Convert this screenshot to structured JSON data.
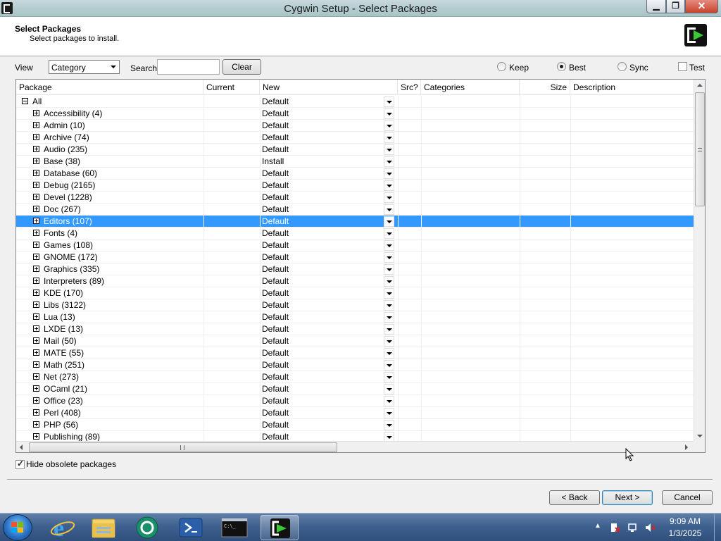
{
  "window": {
    "title": "Cygwin Setup - Select Packages"
  },
  "header": {
    "title": "Select Packages",
    "subtitle": "Select packages to install."
  },
  "toolbar": {
    "view_label": "View",
    "view_value": "Category",
    "search_label": "Search",
    "search_value": "",
    "clear_label": "Clear",
    "modes": [
      {
        "label": "Keep",
        "selected": false
      },
      {
        "label": "Best",
        "selected": true
      },
      {
        "label": "Sync",
        "selected": false
      }
    ],
    "test_label": "Test",
    "test_checked": false
  },
  "columns": [
    "Package",
    "Current",
    "New",
    "Src?",
    "Categories",
    "Size",
    "Description"
  ],
  "rows": [
    {
      "name": "All",
      "new": "Default",
      "level": 0,
      "expanded": true
    },
    {
      "name": "Accessibility (4)",
      "new": "Default",
      "level": 1
    },
    {
      "name": "Admin (10)",
      "new": "Default",
      "level": 1
    },
    {
      "name": "Archive (74)",
      "new": "Default",
      "level": 1
    },
    {
      "name": "Audio (235)",
      "new": "Default",
      "level": 1
    },
    {
      "name": "Base (38)",
      "new": "Install",
      "level": 1
    },
    {
      "name": "Database (60)",
      "new": "Default",
      "level": 1
    },
    {
      "name": "Debug (2165)",
      "new": "Default",
      "level": 1
    },
    {
      "name": "Devel (1228)",
      "new": "Default",
      "level": 1
    },
    {
      "name": "Doc (267)",
      "new": "Default",
      "level": 1
    },
    {
      "name": "Editors (107)",
      "new": "Default",
      "level": 1,
      "selected": true
    },
    {
      "name": "Fonts (4)",
      "new": "Default",
      "level": 1
    },
    {
      "name": "Games (108)",
      "new": "Default",
      "level": 1
    },
    {
      "name": "GNOME (172)",
      "new": "Default",
      "level": 1
    },
    {
      "name": "Graphics (335)",
      "new": "Default",
      "level": 1
    },
    {
      "name": "Interpreters (89)",
      "new": "Default",
      "level": 1
    },
    {
      "name": "KDE (170)",
      "new": "Default",
      "level": 1
    },
    {
      "name": "Libs (3122)",
      "new": "Default",
      "level": 1
    },
    {
      "name": "Lua (13)",
      "new": "Default",
      "level": 1
    },
    {
      "name": "LXDE (13)",
      "new": "Default",
      "level": 1
    },
    {
      "name": "Mail (50)",
      "new": "Default",
      "level": 1
    },
    {
      "name": "MATE (55)",
      "new": "Default",
      "level": 1
    },
    {
      "name": "Math (251)",
      "new": "Default",
      "level": 1
    },
    {
      "name": "Net (273)",
      "new": "Default",
      "level": 1
    },
    {
      "name": "OCaml (21)",
      "new": "Default",
      "level": 1
    },
    {
      "name": "Office (23)",
      "new": "Default",
      "level": 1
    },
    {
      "name": "Perl (408)",
      "new": "Default",
      "level": 1
    },
    {
      "name": "PHP (56)",
      "new": "Default",
      "level": 1
    },
    {
      "name": "Publishing (89)",
      "new": "Default",
      "level": 1
    }
  ],
  "footer": {
    "hide_obsolete_label": "Hide obsolete packages",
    "hide_obsolete_checked": true,
    "back_label": "< Back",
    "next_label": "Next >",
    "cancel_label": "Cancel"
  },
  "taskbar": {
    "apps": [
      "internet-explorer-icon",
      "file-explorer-icon",
      "app-icon",
      "powershell-icon",
      "command-prompt-icon",
      "cygwin-setup-icon"
    ],
    "time": "9:09 AM",
    "date": "1/3/2025"
  },
  "colors": {
    "selection": "#3399ff",
    "taskbar": "#3f6190"
  }
}
